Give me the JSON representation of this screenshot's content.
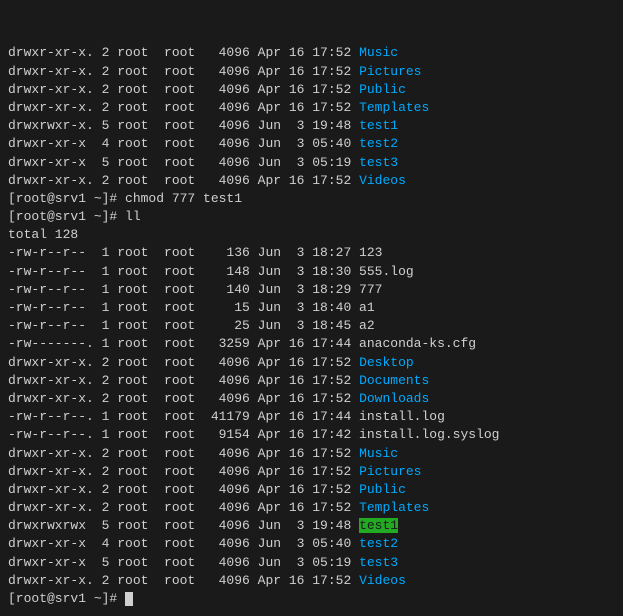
{
  "terminal": {
    "lines": [
      {
        "id": "l1",
        "type": "normal",
        "text": "drwxr-xr-x. 2 root  root   4096 Apr 16 17:52 ",
        "highlight": null,
        "link": "Music",
        "link_color": "cyan"
      },
      {
        "id": "l2",
        "type": "normal",
        "text": "drwxr-xr-x. 2 root  root   4096 Apr 16 17:52 ",
        "highlight": null,
        "link": "Pictures",
        "link_color": "cyan"
      },
      {
        "id": "l3",
        "type": "normal",
        "text": "drwxr-xr-x. 2 root  root   4096 Apr 16 17:52 ",
        "highlight": null,
        "link": "Public",
        "link_color": "cyan"
      },
      {
        "id": "l4",
        "type": "normal",
        "text": "drwxr-xr-x. 2 root  root   4096 Apr 16 17:52 ",
        "highlight": null,
        "link": "Templates",
        "link_color": "cyan"
      },
      {
        "id": "l5",
        "type": "normal",
        "text": "drwxrwxr-x. 5 root  root   4096 Jun  3 19:48 ",
        "highlight": null,
        "link": "test1",
        "link_color": "cyan"
      },
      {
        "id": "l6",
        "type": "normal",
        "text": "drwxr-xr-x  4 root  root   4096 Jun  3 05:40 ",
        "highlight": null,
        "link": "test2",
        "link_color": "cyan"
      },
      {
        "id": "l7",
        "type": "normal",
        "text": "drwxr-xr-x  5 root  root   4096 Jun  3 05:19 ",
        "highlight": null,
        "link": "test3",
        "link_color": "cyan"
      },
      {
        "id": "l8",
        "type": "normal",
        "text": "drwxr-xr-x. 2 root  root   4096 Apr 16 17:52 ",
        "highlight": null,
        "link": "Videos",
        "link_color": "cyan"
      },
      {
        "id": "l9",
        "type": "cmd",
        "text": "[root@srv1 ~]# chmod 777 test1",
        "link": null
      },
      {
        "id": "l10",
        "type": "cmd",
        "text": "[root@srv1 ~]# ll",
        "link": null
      },
      {
        "id": "l11",
        "type": "normal",
        "text": "total 128",
        "link": null
      },
      {
        "id": "l12",
        "type": "normal",
        "text": "-rw-r--r--  1 root  root    136 Jun  3 18:27 123",
        "link": null
      },
      {
        "id": "l13",
        "type": "normal",
        "text": "-rw-r--r--  1 root  root    148 Jun  3 18:30 555.log",
        "link": null
      },
      {
        "id": "l14",
        "type": "normal",
        "text": "-rw-r--r--  1 root  root    140 Jun  3 18:29 777",
        "link": null
      },
      {
        "id": "l15",
        "type": "normal",
        "text": "-rw-r--r--  1 root  root     15 Jun  3 18:40 a1",
        "link": null
      },
      {
        "id": "l16",
        "type": "normal",
        "text": "-rw-r--r--  1 root  root     25 Jun  3 18:45 a2",
        "link": null
      },
      {
        "id": "l17",
        "type": "normal",
        "text": "-rw-------. 1 root  root   3259 Apr 16 17:44 anaconda-ks.cfg",
        "link": null
      },
      {
        "id": "l18",
        "type": "normal",
        "text": "drwxr-xr-x. 2 root  root   4096 Apr 16 17:52 ",
        "link": "Desktop",
        "link_color": "cyan"
      },
      {
        "id": "l19",
        "type": "normal",
        "text": "drwxr-xr-x. 2 root  root   4096 Apr 16 17:52 ",
        "link": "Documents",
        "link_color": "cyan"
      },
      {
        "id": "l20",
        "type": "normal",
        "text": "drwxr-xr-x. 2 root  root   4096 Apr 16 17:52 ",
        "link": "Downloads",
        "link_color": "cyan"
      },
      {
        "id": "l21",
        "type": "normal",
        "text": "-rw-r--r--. 1 root  root  41179 Apr 16 17:44 install.log",
        "link": null
      },
      {
        "id": "l22",
        "type": "normal",
        "text": "-rw-r--r--. 1 root  root   9154 Apr 16 17:42 install.log.syslog",
        "link": null
      },
      {
        "id": "l23",
        "type": "normal",
        "text": "drwxr-xr-x. 2 root  root   4096 Apr 16 17:52 ",
        "link": "Music",
        "link_color": "cyan"
      },
      {
        "id": "l24",
        "type": "normal",
        "text": "drwxr-xr-x. 2 root  root   4096 Apr 16 17:52 ",
        "link": "Pictures",
        "link_color": "cyan"
      },
      {
        "id": "l25",
        "type": "normal",
        "text": "drwxr-xr-x. 2 root  root   4096 Apr 16 17:52 ",
        "link": "Public",
        "link_color": "cyan"
      },
      {
        "id": "l26",
        "type": "normal",
        "text": "drwxr-xr-x. 2 root  root   4096 Apr 16 17:52 ",
        "link": "Templates",
        "link_color": "cyan"
      },
      {
        "id": "l27",
        "type": "normal",
        "text": "drwxrwxrwx  5 root  root   4096 Jun  3 19:48 ",
        "link": "test1",
        "link_color": "green-highlight"
      },
      {
        "id": "l28",
        "type": "normal",
        "text": "drwxr-xr-x  4 root  root   4096 Jun  3 05:40 ",
        "link": "test2",
        "link_color": "cyan"
      },
      {
        "id": "l29",
        "type": "normal",
        "text": "drwxr-xr-x  5 root  root   4096 Jun  3 05:19 ",
        "link": "test3",
        "link_color": "cyan"
      },
      {
        "id": "l30",
        "type": "normal",
        "text": "drwxr-xr-x. 2 root  root   4096 Apr 16 17:52 ",
        "link": "Videos",
        "link_color": "cyan"
      },
      {
        "id": "l31",
        "type": "cmd",
        "text": "[root@srv1 ~]# ",
        "link": null,
        "cursor": true
      }
    ]
  }
}
